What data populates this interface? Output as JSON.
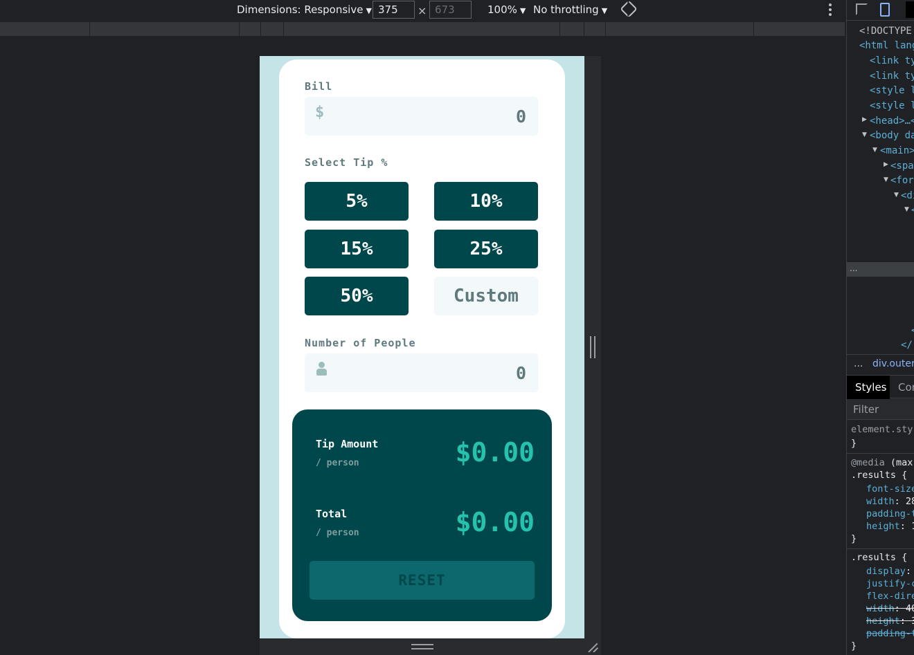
{
  "toolbar": {
    "dimensions_label": "Dimensions: Responsive",
    "width_value": "375",
    "height_value": "673",
    "times": "×",
    "zoom": "100%",
    "throttling": "No throttling",
    "caret": "▼"
  },
  "app": {
    "bill_label": "Bill",
    "bill_prefix": "$",
    "bill_value": "0",
    "tip_label": "Select Tip %",
    "tip_options": [
      "5%",
      "10%",
      "15%",
      "25%",
      "50%"
    ],
    "custom_placeholder": "Custom",
    "people_label": "Number of People",
    "people_value": "0",
    "tip_amount_label": "Tip Amount",
    "per_person": "/ person",
    "tip_amount_value": "$0.00",
    "total_label": "Total",
    "total_value": "$0.00",
    "reset_label": "RESET",
    "colors": {
      "page_bg": "#c5e4e7",
      "dark_cyan": "#00474b",
      "accent": "#26c2ae",
      "reset_bg": "#0d686d"
    }
  },
  "devtools": {
    "dom": [
      "<!DOCTYPE",
      "<html lang",
      "<link ty",
      "<link ty",
      "<style l",
      "<style l",
      "<head>…</",
      "<body da",
      "<main>",
      "<spa",
      "<for",
      "<di",
      "<",
      "<",
      "</"
    ],
    "ellipsis": "...",
    "breadcrumb_ellipsis": "...",
    "breadcrumb": "div.outer-",
    "tab_styles": "Styles",
    "tab_computed": "Cor",
    "filter": "Filter",
    "css": {
      "element_style": "element.sty",
      "close_brace": "}",
      "media": "@media",
      "media_rest": "(max",
      "results_open": ".results {",
      "font_size": "font-size",
      "width": "width",
      "width_val": "28",
      "padding_t": "padding-t",
      "height": "height",
      "height_val": "1",
      "display": "display",
      "justify": "justify-c",
      "flex_dir": "flex-dire",
      "width2": "width",
      "width2_val": "40",
      "height2": "height",
      "height2_val": "3",
      "padding2": "padding-t",
      "colon": ":"
    }
  }
}
